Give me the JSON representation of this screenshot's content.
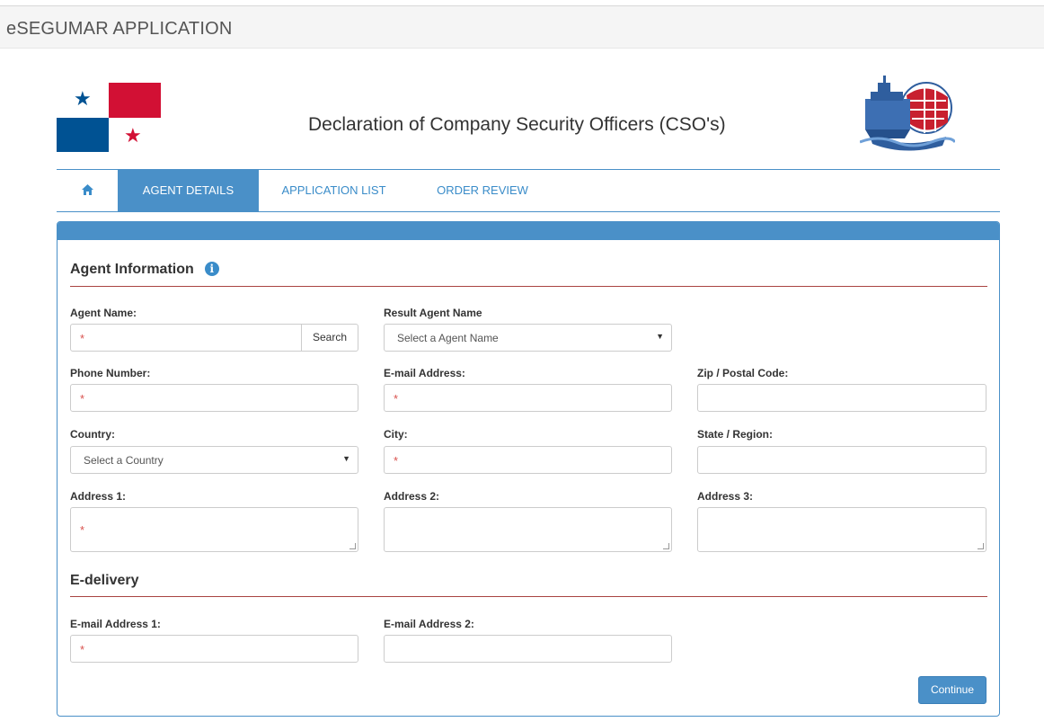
{
  "app": {
    "title": "eSEGUMAR APPLICATION"
  },
  "header": {
    "heading": "Declaration of Company Security Officers (CSO's)"
  },
  "tabs": [
    {
      "id": "home",
      "icon": "home-icon"
    },
    {
      "id": "agent_details",
      "label": "AGENT DETAILS",
      "active": true
    },
    {
      "id": "application_list",
      "label": "APPLICATION LIST"
    },
    {
      "id": "order_review",
      "label": "ORDER REVIEW"
    }
  ],
  "agent_info": {
    "title": "Agent Information",
    "info_icon": "info-circle-icon",
    "agent_name": {
      "label": "Agent Name:",
      "value": "",
      "required": true,
      "search_label": "Search"
    },
    "result_agent_name": {
      "label": "Result Agent Name",
      "selected": "Select a Agent Name"
    },
    "phone_number": {
      "label": "Phone Number:",
      "value": "",
      "required": true
    },
    "email_address": {
      "label": "E-mail Address:",
      "value": "",
      "required": true
    },
    "zip": {
      "label": "Zip / Postal Code:",
      "value": ""
    },
    "country": {
      "label": "Country:",
      "selected": "Select a Country"
    },
    "city": {
      "label": "City:",
      "value": "",
      "required": true
    },
    "state": {
      "label": "State / Region:",
      "value": ""
    },
    "address1": {
      "label": "Address 1:",
      "value": "",
      "required": true
    },
    "address2": {
      "label": "Address 2:",
      "value": ""
    },
    "address3": {
      "label": "Address 3:",
      "value": ""
    }
  },
  "edelivery": {
    "title": "E-delivery",
    "email1": {
      "label": "E-mail Address 1:",
      "value": "",
      "required": true
    },
    "email2": {
      "label": "E-mail Address 2:",
      "value": ""
    }
  },
  "actions": {
    "continue_label": "Continue"
  },
  "required_marker": "*",
  "colors": {
    "primary": "#4a90c8",
    "link": "#3a8cc9",
    "required": "#d9534f",
    "section_rule": "#a94442",
    "flag_red": "#d21034",
    "flag_blue": "#005293"
  }
}
